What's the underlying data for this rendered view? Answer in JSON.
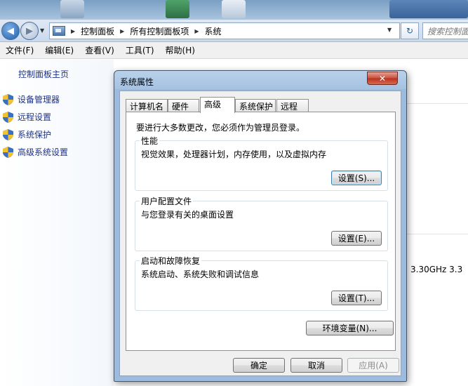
{
  "window": {
    "address": {
      "crumbs": [
        "控制面板",
        "所有控制面板项",
        "系统"
      ],
      "search_placeholder": "搜索控制面"
    },
    "menu": [
      "文件(F)",
      "编辑(E)",
      "查看(V)",
      "工具(T)",
      "帮助(H)"
    ],
    "left_pane": {
      "home_link": "控制面板主页",
      "links": [
        "设备管理器",
        "远程设置",
        "系统保护",
        "高级系统设置"
      ]
    },
    "background_text": {
      "cpu_speed": "3.30GHz   3.3"
    }
  },
  "dialog": {
    "title": "系统属性",
    "tabs": [
      "计算机名",
      "硬件",
      "高级",
      "系统保护",
      "远程"
    ],
    "active_tab": "高级",
    "admin_note": "要进行大多数更改，您必须作为管理员登录。",
    "groups": [
      {
        "title": "性能",
        "description": "视觉效果，处理器计划，内存使用，以及虚拟内存",
        "button": "设置(S)..."
      },
      {
        "title": "用户配置文件",
        "description": "与您登录有关的桌面设置",
        "button": "设置(E)..."
      },
      {
        "title": "启动和故障恢复",
        "description": "系统启动、系统失败和调试信息",
        "button": "设置(T)..."
      }
    ],
    "env_button": "环境变量(N)...",
    "ok_button": "确定",
    "cancel_button": "取消",
    "apply_button": "应用(A)",
    "close_glyph": "✕"
  },
  "icons": {
    "back": "◀",
    "forward": "▶",
    "dropdown": "▼",
    "breadcrumb_arrow": "▶",
    "refresh": "↻"
  },
  "colors": {
    "link": "#1e3287",
    "close_red": "#c9503c",
    "titlebar": "#b9d1ea"
  }
}
